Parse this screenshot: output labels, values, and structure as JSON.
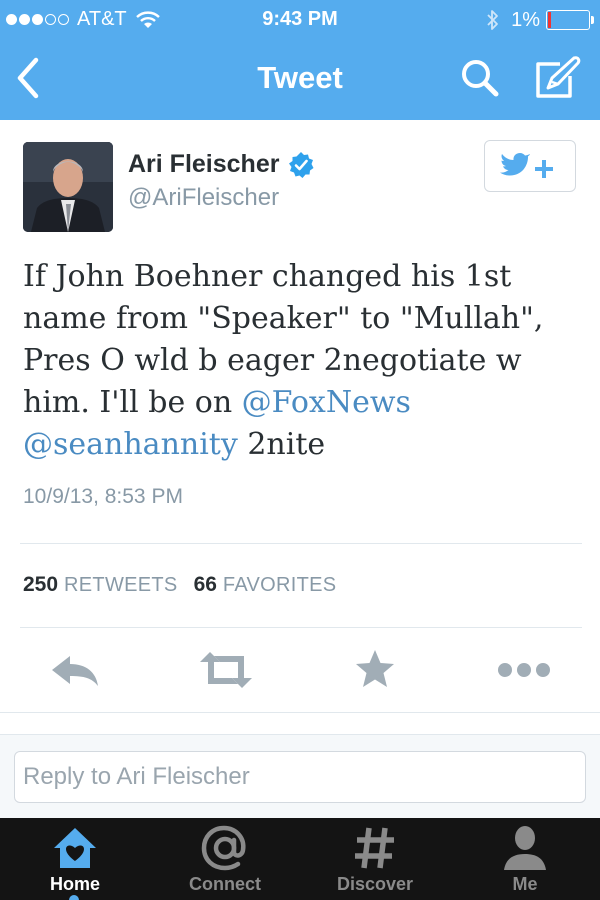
{
  "status_bar": {
    "carrier": "AT&T",
    "time": "9:43 PM",
    "battery": "1%"
  },
  "nav": {
    "title": "Tweet"
  },
  "tweet": {
    "author_name": "Ari Fleischer",
    "author_handle": "@AriFleischer",
    "text_parts": [
      "If John Boehner changed his 1st name from \"Speaker\" to \"Mullah\", Pres O wld b eager 2negotiate w him. I'll be on ",
      "@FoxNews",
      " ",
      "@seanhannity",
      " 2nite"
    ],
    "timestamp": "10/9/13, 8:53 PM",
    "retweets": "250",
    "retweets_label": "RETWEETS",
    "favorites": "66",
    "favorites_label": "FAVORITES"
  },
  "reply": {
    "placeholder": "Reply to Ari Fleischer"
  },
  "tabs": [
    {
      "label": "Home"
    },
    {
      "label": "Connect"
    },
    {
      "label": "Discover"
    },
    {
      "label": "Me"
    }
  ],
  "colors": {
    "brand": "#55acee",
    "mention": "#4a8bc2",
    "tabbar": "#141414"
  },
  "icons": [
    "back-icon",
    "search-icon",
    "compose-icon",
    "verified-icon",
    "follow-icon",
    "reply-icon",
    "retweet-icon",
    "favorite-icon",
    "more-icon",
    "home-icon",
    "connect-icon",
    "discover-icon",
    "me-icon"
  ]
}
